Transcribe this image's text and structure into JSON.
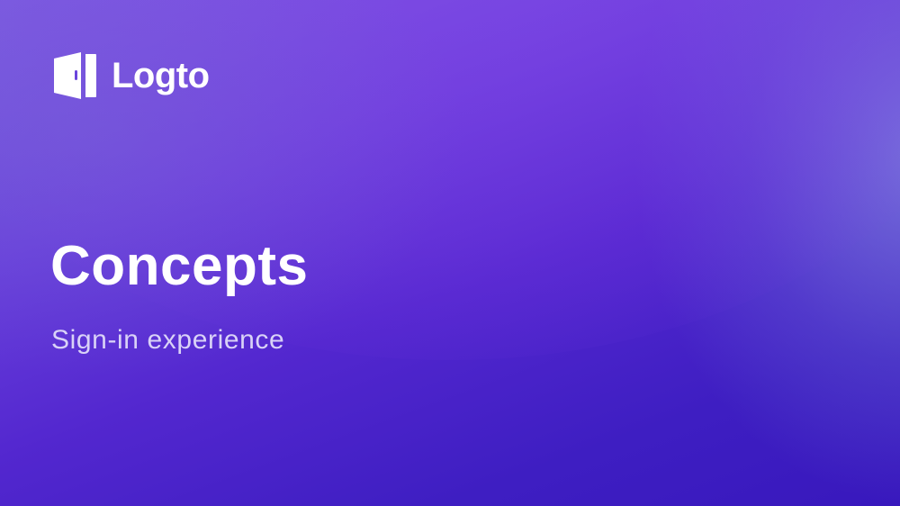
{
  "brand": {
    "name": "Logto",
    "logo_icon": "logto-door-icon"
  },
  "slide": {
    "title": "Concepts",
    "subtitle": "Sign-in experience"
  },
  "colors": {
    "background_top": "#7a5fe0",
    "background_mid": "#5327cf",
    "background_bottom": "#3818bd",
    "text_primary": "#ffffff",
    "text_secondary": "#d9d2f7"
  }
}
